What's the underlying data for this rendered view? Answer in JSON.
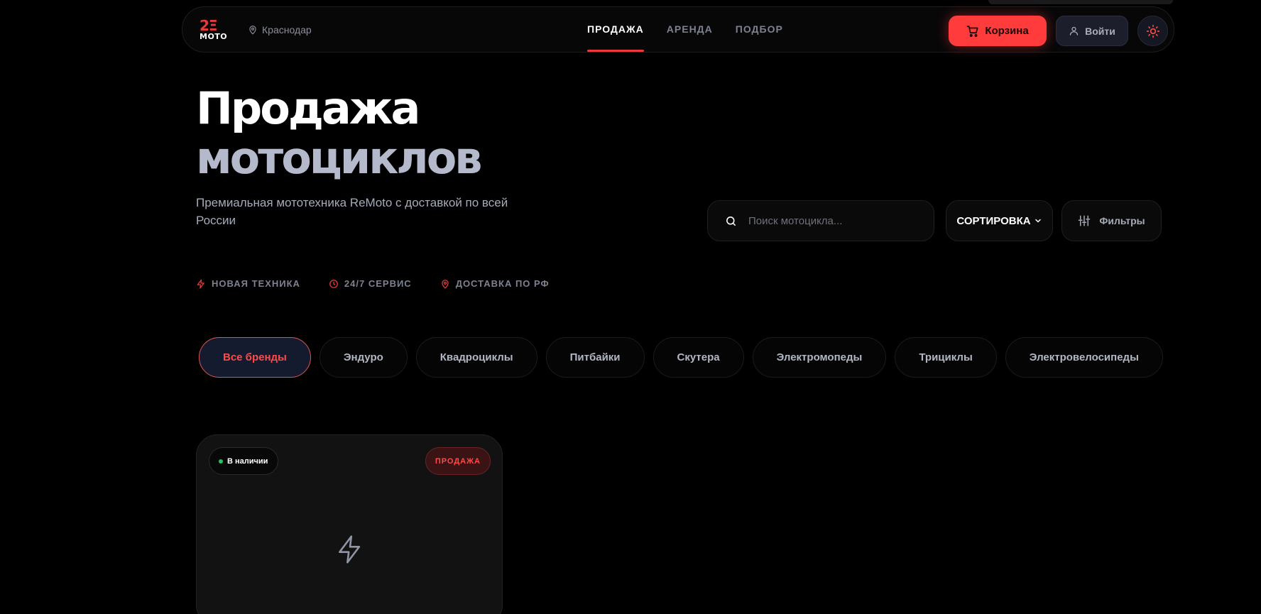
{
  "header": {
    "logo_top": "2Ξ",
    "logo_bottom": "MOTO",
    "city": "Краснодар",
    "nav": [
      "ПРОДАЖА",
      "АРЕНДА",
      "ПОДБОР"
    ],
    "cart_label": "Корзина",
    "login_label": "Войти"
  },
  "hero": {
    "title_line1": "Продажа",
    "title_line2": "мотоциклов",
    "subtitle": "Премиальная мототехника ReMoto с доставкой по всей России"
  },
  "controls": {
    "search_placeholder": "Поиск мотоцикла...",
    "sort_label": "СОРТИРОВКА",
    "filters_label": "Фильтры"
  },
  "features": [
    "НОВАЯ ТЕХНИКА",
    "24/7 СЕРВИС",
    "ДОСТАВКА ПО РФ"
  ],
  "categories": [
    "Все бренды",
    "Эндуро",
    "Квадроциклы",
    "Питбайки",
    "Скутера",
    "Электромопеды",
    "Трициклы",
    "Электровелосипеды"
  ],
  "card": {
    "stock": "В наличии",
    "badge": "ПРОДАЖА"
  },
  "colors": {
    "accent": "#ff3b3b",
    "background": "#000000",
    "in_stock": "#22c55e"
  },
  "icons": {
    "city": "map-pin-icon",
    "cart": "cart-icon",
    "login": "user-icon",
    "theme": "sun-icon",
    "search": "search-icon",
    "sort": "chevron-down-icon",
    "filters": "sliders-icon",
    "features": [
      "bolt-icon",
      "clock-icon",
      "map-pin-icon"
    ],
    "card_placeholder": "bolt-icon"
  }
}
